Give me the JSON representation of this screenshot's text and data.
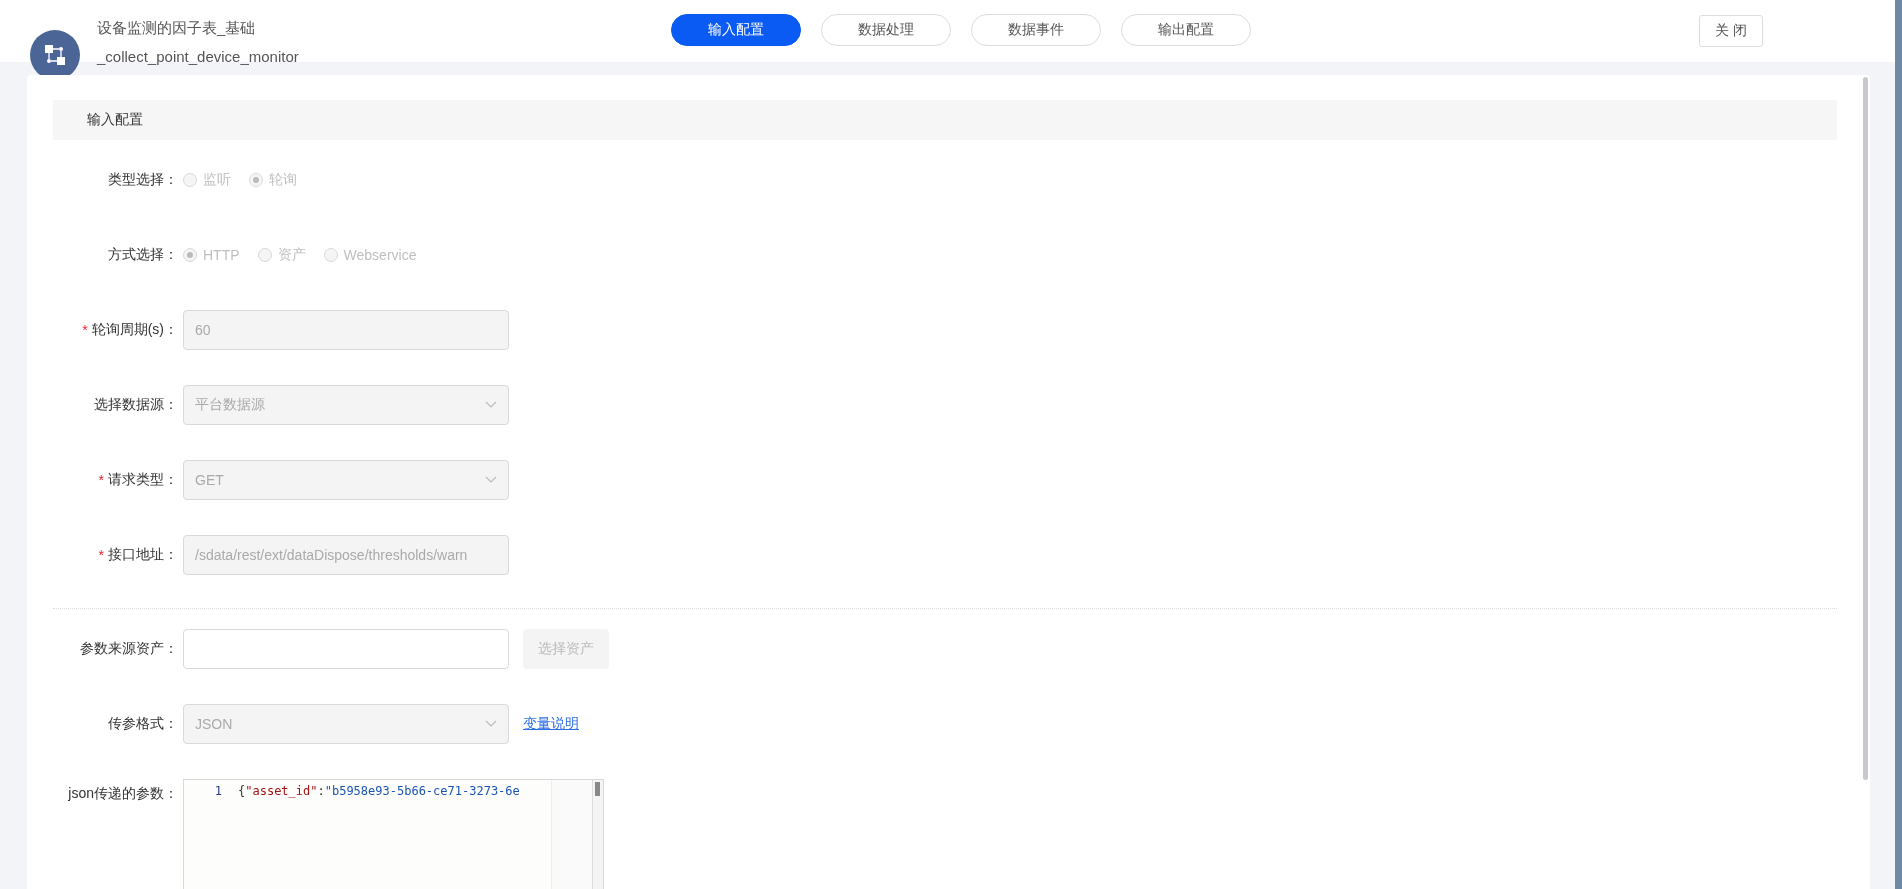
{
  "header": {
    "title": "设备监测的因子表_基础",
    "subtitle": "_collect_point_device_monitor"
  },
  "tabs": [
    {
      "label": "输入配置",
      "selected": true
    },
    {
      "label": "数据处理",
      "selected": false
    },
    {
      "label": "数据事件",
      "selected": false
    },
    {
      "label": "输出配置",
      "selected": false
    }
  ],
  "close_button": {
    "label": "关 闭"
  },
  "section": {
    "title": "输入配置"
  },
  "fields": [
    {
      "kind": "radio",
      "label": "类型选择：",
      "disabled": true,
      "options": [
        {
          "label": "监听",
          "selected": false
        },
        {
          "label": "轮询",
          "selected": true
        }
      ]
    },
    {
      "kind": "radio",
      "label": "方式选择：",
      "disabled": true,
      "options": [
        {
          "label": "HTTP",
          "selected": true
        },
        {
          "label": "资产",
          "selected": false
        },
        {
          "label": "Webservice",
          "selected": false
        }
      ]
    },
    {
      "kind": "input",
      "marker": "*",
      "label": "轮询周期(s)：",
      "value": "60",
      "disabled": true
    },
    {
      "kind": "select",
      "label": "选择数据源：",
      "value": "平台数据源",
      "disabled": true
    },
    {
      "kind": "select",
      "marker": "*",
      "label": "请求类型：",
      "value": "GET",
      "disabled": true
    },
    {
      "kind": "input",
      "marker": "*",
      "label": "接口地址：",
      "value": "/sdata/rest/ext/dataDispose/thresholds/warn",
      "disabled": true
    }
  ],
  "param_fields": [
    {
      "kind": "input",
      "label": "参数来源资产：",
      "disabled": false,
      "button": {
        "label": "选择资产",
        "disabled": true
      }
    },
    {
      "kind": "select",
      "label": "传参格式：",
      "value": "JSON",
      "disabled": true,
      "link": "变量说明"
    },
    {
      "kind": "editor",
      "label": "json传递的参数：",
      "lines": [
        {
          "number": "1",
          "tokens": [
            {
              "kind": "punct",
              "text": "{"
            },
            {
              "kind": "key",
              "text": "\"asset_id\""
            },
            {
              "kind": "punct",
              "text": ":"
            },
            {
              "kind": "string",
              "text": "\"b5958e93-5b66-ce71-3273-6e"
            }
          ]
        }
      ]
    }
  ]
}
